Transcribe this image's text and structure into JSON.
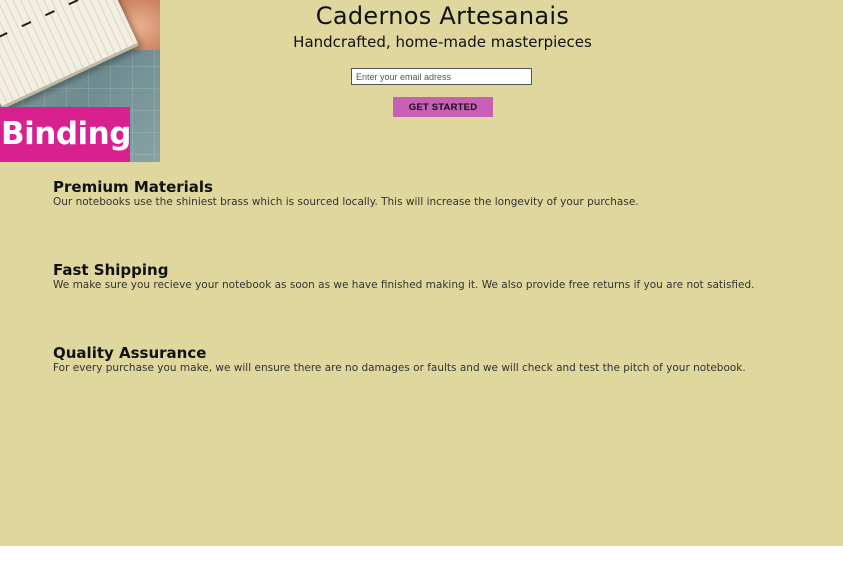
{
  "header": {
    "hero_banner_text": "Binding",
    "brand_title": "Cadernos Artesanais",
    "tagline": "Handcrafted, home-made masterpieces",
    "email_placeholder": "Enter your email adress",
    "cta_label": "GET STARTED"
  },
  "features": [
    {
      "title": "Premium Materials",
      "description": "Our notebooks use the shiniest brass which is sourced locally. This will increase the longevity of your purchase."
    },
    {
      "title": "Fast Shipping",
      "description": "We make sure you recieve your notebook as soon as we have finished making it. We also provide free returns if you are not satisfied."
    },
    {
      "title": "Quality Assurance",
      "description": "For every purchase you make, we will ensure there are no damages or faults and we will check and test the pitch of your notebook."
    }
  ],
  "colors": {
    "page_background": "#e0d79f",
    "banner_magenta": "#d9208f",
    "button_pink": "#c65fb5"
  }
}
